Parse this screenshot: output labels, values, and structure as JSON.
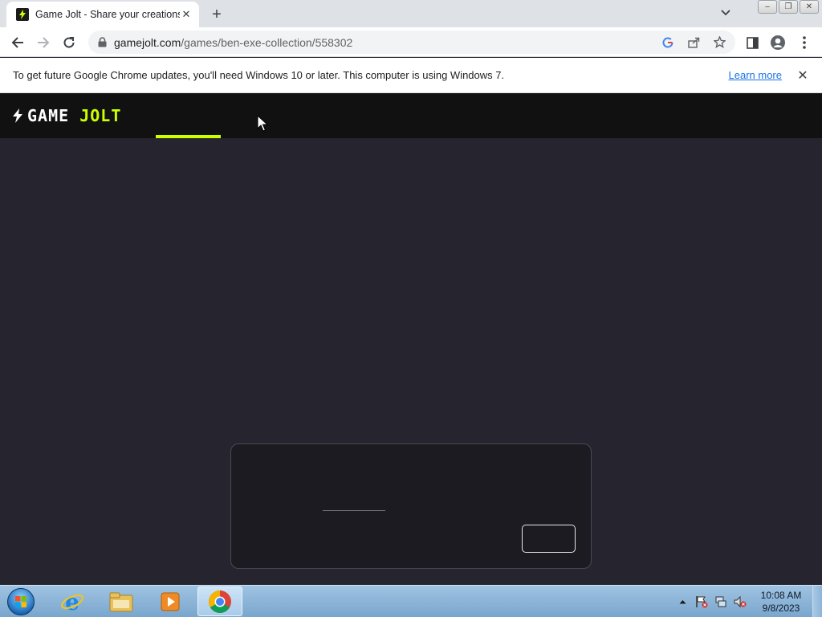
{
  "browser": {
    "tab": {
      "title": "Game Jolt - Share your creations",
      "close_glyph": "✕"
    },
    "new_tab_glyph": "+",
    "window_controls": [
      "–",
      "❐",
      "✕"
    ],
    "url_host": "gamejolt.com",
    "url_path": "/games/ben-exe-collection/558302",
    "infobar": {
      "message": "To get future Google Chrome updates, you'll need Windows 10 or later. This computer is using Windows 7.",
      "link": "Learn more",
      "close_glyph": "✕"
    }
  },
  "site": {
    "logo_word1": "GAME",
    "logo_word2": "JOLT",
    "accent_color": "#ccff00",
    "header_color": "#111111",
    "background_color": "#26242e"
  },
  "taskbar": {
    "apps": [
      "start-orb",
      "internet-explorer-icon",
      "windows-explorer-icon",
      "media-player-icon",
      "chrome-icon"
    ],
    "active_app": "chrome-icon",
    "clock_time": "10:08 AM",
    "clock_date": "9/8/2023"
  }
}
